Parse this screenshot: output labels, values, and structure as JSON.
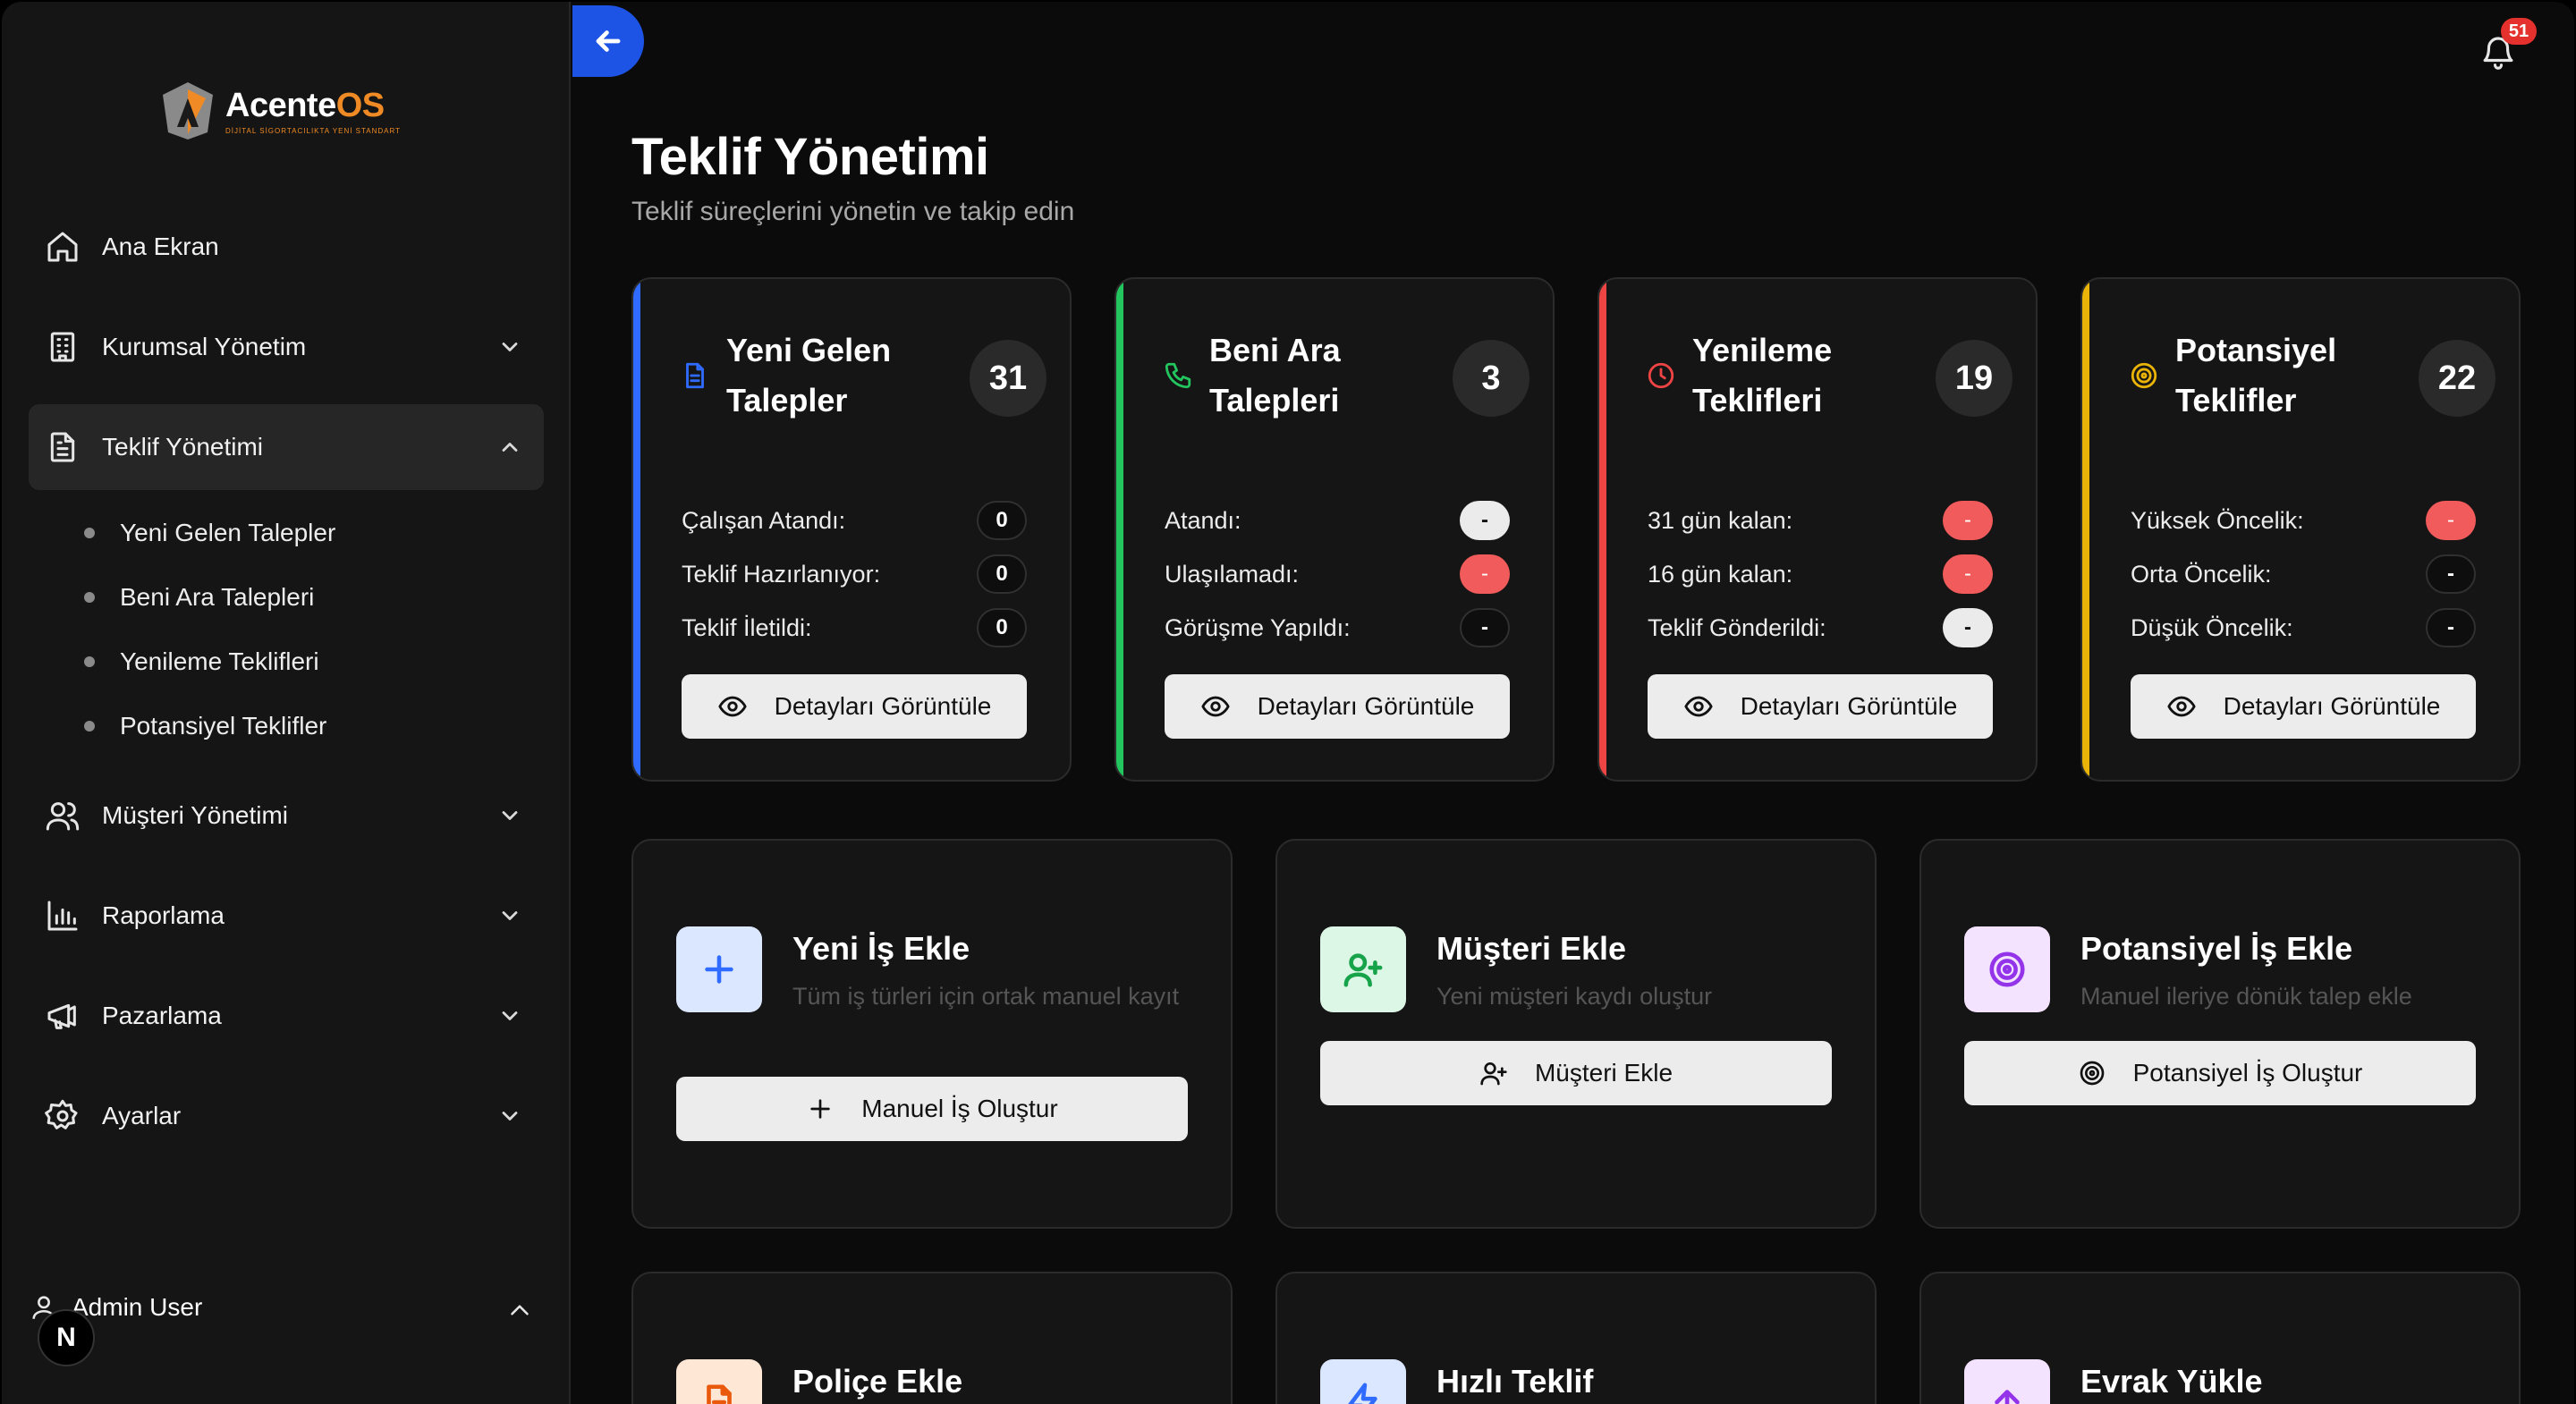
{
  "brand": {
    "name_main": "Acente",
    "name_accent": "OS",
    "tagline": "DİJİTAL SİGORTACILIKTA YENİ STANDART",
    "accent_color": "#f08a24"
  },
  "sidebar": {
    "items": [
      {
        "label": "Ana Ekran",
        "icon": "home-icon"
      },
      {
        "label": "Kurumsal Yönetim",
        "icon": "building-icon"
      },
      {
        "label": "Teklif Yönetimi",
        "icon": "document-icon",
        "active": true,
        "children": [
          "Yeni Gelen Talepler",
          "Beni Ara Talepleri",
          "Yenileme Teklifleri",
          "Potansiyel Teklifler"
        ]
      },
      {
        "label": "Müşteri Yönetimi",
        "icon": "users-icon"
      },
      {
        "label": "Raporlama",
        "icon": "bar-chart-icon"
      },
      {
        "label": "Pazarlama",
        "icon": "megaphone-icon"
      },
      {
        "label": "Ayarlar",
        "icon": "gear-icon"
      }
    ],
    "user": {
      "name": "Admin User",
      "avatar_letter": "N"
    }
  },
  "topbar": {
    "notification_count": "51",
    "back_color": "#1e54e6"
  },
  "page": {
    "title": "Teklif Yönetimi",
    "subtitle": "Teklif süreçlerini yönetin ve takip edin"
  },
  "stats": [
    {
      "title": "Yeni Gelen Talepler",
      "count": "31",
      "accent": "#2f6bff",
      "icon": "file-icon",
      "rows": [
        {
          "label": "Çalışan Atandı:",
          "value": "0"
        },
        {
          "label": "Teklif Hazırlanıyor:",
          "value": "0"
        },
        {
          "label": "Teklif İletildi:",
          "value": "0"
        }
      ],
      "button": "Detayları Görüntüle"
    },
    {
      "title": "Beni Ara Talepleri",
      "count": "3",
      "accent": "#22c55e",
      "icon": "phone-icon",
      "rows": [
        {
          "label": "Atandı:",
          "value": "-"
        },
        {
          "label": "Ulaşılamadı:",
          "value": "-"
        },
        {
          "label": "Görüşme Yapıldı:",
          "value": "-"
        }
      ],
      "button": "Detayları Görüntüle"
    },
    {
      "title": "Yenileme Teklifleri",
      "count": "19",
      "accent": "#ef4444",
      "icon": "clock-icon",
      "rows": [
        {
          "label": "31 gün kalan:",
          "value": "-"
        },
        {
          "label": "16 gün kalan:",
          "value": "-"
        },
        {
          "label": "Teklif Gönderildi:",
          "value": "-"
        }
      ],
      "button": "Detayları Görüntüle"
    },
    {
      "title": "Potansiyel Teklifler",
      "count": "22",
      "accent": "#eab308",
      "icon": "target-icon",
      "rows": [
        {
          "label": "Yüksek Öncelik:",
          "value": "-"
        },
        {
          "label": "Orta Öncelik:",
          "value": "-"
        },
        {
          "label": "Düşük Öncelik:",
          "value": "-"
        }
      ],
      "button": "Detayları Görüntüle"
    }
  ],
  "actions": [
    {
      "title": "Yeni İş Ekle",
      "desc": "Tüm iş türleri için ortak manuel kayıt",
      "button": "Manuel İş Oluştur",
      "icon": "plus-icon",
      "icon_bg": "#dbe7ff",
      "icon_color": "#2f6bff"
    },
    {
      "title": "Müşteri Ekle",
      "desc": "Yeni müşteri kaydı oluştur",
      "button": "Müşteri Ekle",
      "icon": "user-plus-icon",
      "icon_bg": "#dcf7e6",
      "icon_color": "#16a34a"
    },
    {
      "title": "Potansiyel İş Ekle",
      "desc": "Manuel ileriye dönük talep ekle",
      "button": "Potansiyel İş Oluştur",
      "icon": "target-icon",
      "icon_bg": "#f3e3ff",
      "icon_color": "#9333ea"
    },
    {
      "title": "Poliçe Ekle",
      "icon": "file-icon",
      "icon_bg": "#ffe7d6",
      "icon_color": "#ea580c"
    },
    {
      "title": "Hızlı Teklif",
      "icon": "bolt-icon",
      "icon_bg": "#dbe7ff",
      "icon_color": "#2f6bff"
    },
    {
      "title": "Evrak Yükle",
      "icon": "upload-icon",
      "icon_bg": "#f3e3ff",
      "icon_color": "#9333ea"
    }
  ]
}
